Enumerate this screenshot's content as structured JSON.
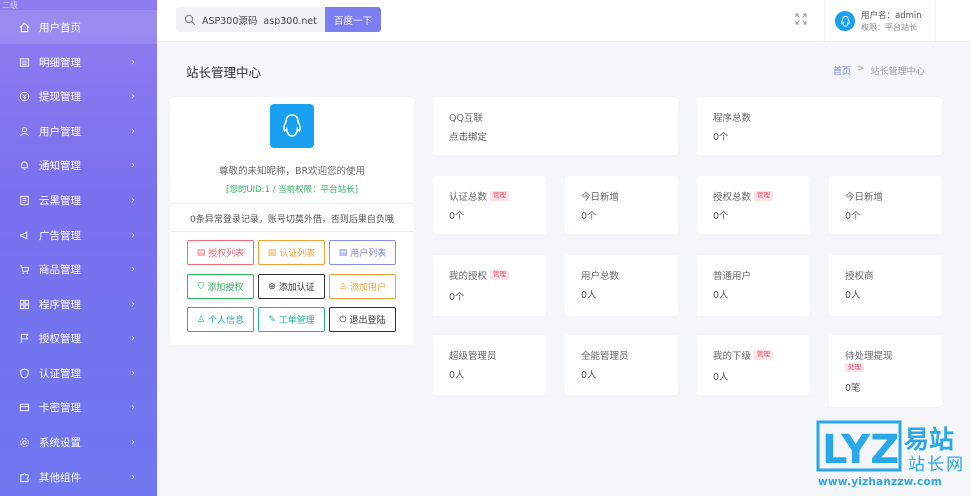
{
  "window": {
    "corner_text": "二级"
  },
  "sidebar": {
    "items": [
      {
        "label": "用户首页",
        "icon": "home-icon"
      },
      {
        "label": "明细管理",
        "icon": "list-icon"
      },
      {
        "label": "提现管理",
        "icon": "coin-icon"
      },
      {
        "label": "用户管理",
        "icon": "user-icon"
      },
      {
        "label": "通知管理",
        "icon": "bell-icon"
      },
      {
        "label": "云黑管理",
        "icon": "doc-icon"
      },
      {
        "label": "广告管理",
        "icon": "megaphone-icon"
      },
      {
        "label": "商品管理",
        "icon": "cart-icon"
      },
      {
        "label": "程序管理",
        "icon": "grid-icon"
      },
      {
        "label": "授权管理",
        "icon": "flag-icon"
      },
      {
        "label": "认证管理",
        "icon": "shield-icon"
      },
      {
        "label": "卡密管理",
        "icon": "card-icon"
      },
      {
        "label": "系统设置",
        "icon": "gear-icon"
      },
      {
        "label": "其他组件",
        "icon": "puzzle-icon"
      }
    ]
  },
  "header": {
    "search_value": "ASP300源码  asp300.net",
    "search_button": "百度一下",
    "user_name": "用户名：admin",
    "user_role": "权限：平台站长"
  },
  "page": {
    "title": "站长管理中心",
    "breadcrumb_home": "首页",
    "breadcrumb_sep": ">",
    "breadcrumb_current": "站长管理中心"
  },
  "profile": {
    "welcome": "尊敬的未知昵称，BR欢迎您的使用",
    "uid_line": "[您的UID:1 / 当前权限：平台站长]",
    "warning": "0条异常登录记录，账号切莫外借，否则后果自负哦",
    "buttons": [
      {
        "label": "授权列表",
        "icon": "doc-icon",
        "color": "#f06b7a"
      },
      {
        "label": "认证列表",
        "icon": "doc-icon",
        "color": "#f2a33a"
      },
      {
        "label": "用户列表",
        "icon": "doc-icon",
        "color": "#8a8ef2"
      },
      {
        "label": "添加授权",
        "icon": "shield-check-icon",
        "color": "#2db55d"
      },
      {
        "label": "添加认证",
        "icon": "plus-circle-icon",
        "color": "#333333"
      },
      {
        "label": "添加用户",
        "icon": "user-icon",
        "color": "#f2a33a"
      },
      {
        "label": "个人信息",
        "icon": "user-icon",
        "color": "#1fb3a0"
      },
      {
        "label": "工单管理",
        "icon": "edit-icon",
        "color": "#1fb3a0"
      },
      {
        "label": "退出登陆",
        "icon": "power-icon",
        "color": "#333333"
      }
    ]
  },
  "stats": {
    "qq": {
      "title": "QQ互联",
      "value": "点击绑定"
    },
    "program_total": {
      "title": "程序总数",
      "value": "0个"
    },
    "auth_cert_total": {
      "title": "认证总数",
      "badge": "管理",
      "value": "0个"
    },
    "today_new_1": {
      "title": "今日新增",
      "value": "0个"
    },
    "auth_total": {
      "title": "授权总数",
      "badge": "管理",
      "value": "0个"
    },
    "today_new_2": {
      "title": "今日新增",
      "value": "0个"
    },
    "my_auth": {
      "title": "我的授权",
      "badge": "管理",
      "value": "0个"
    },
    "user_total": {
      "title": "用户总数",
      "value": "0人"
    },
    "normal_user": {
      "title": "普通用户",
      "value": "0人"
    },
    "auth_merchant": {
      "title": "授权商",
      "value": "0人"
    },
    "super_admin": {
      "title": "超级管理员",
      "value": "0人"
    },
    "all_admin": {
      "title": "全能管理员",
      "value": "0人"
    },
    "my_sub": {
      "title": "我的下级",
      "badge": "管理",
      "value": "0人"
    },
    "pending_withdraw": {
      "title": "待处理提现",
      "badge": "处理",
      "value": "0笔"
    }
  },
  "watermark": {
    "logo_letters": "LYZ",
    "cn_top": "易站",
    "cn_bottom": "站长网",
    "url": "www.yizhanzzw.com"
  },
  "colors": {
    "sidebar_top": "#8f7df0",
    "sidebar_bottom": "#6f78f0",
    "accent": "#7b7ef0",
    "qq_blue": "#1aa0f0",
    "badge_bg": "#fde2e6",
    "badge_text": "#e8506a"
  }
}
